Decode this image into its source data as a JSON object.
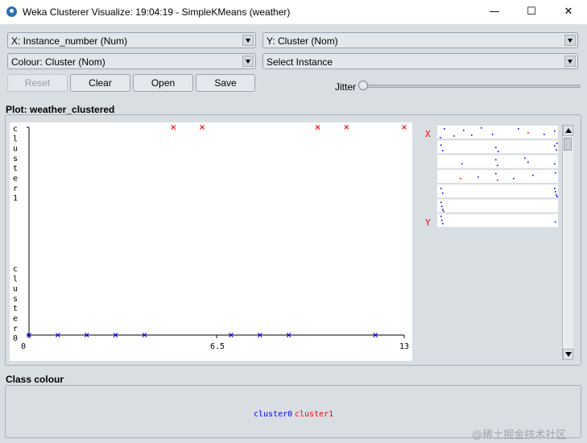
{
  "window": {
    "title": "Weka Clusterer Visualize: 19:04:19 - SimpleKMeans (weather)",
    "minimize_glyph": "—",
    "maximize_glyph": "☐",
    "close_glyph": "✕"
  },
  "controls": {
    "x_axis": "X: Instance_number (Num)",
    "y_axis": "Y: Cluster (Nom)",
    "colour": "Colour: Cluster (Nom)",
    "select_instance": "Select Instance",
    "buttons": {
      "reset": "Reset",
      "clear": "Clear",
      "open": "Open",
      "save": "Save"
    },
    "jitter_label": "Jitter",
    "jitter_value": 0
  },
  "plot": {
    "title": "Plot: weather_clustered",
    "y_top_label": "cluster1",
    "y_bottom_label": "cluster0",
    "x_ticks": [
      "0",
      "6.5",
      "13"
    ],
    "marker": "x"
  },
  "matrix": {
    "x_label": "X",
    "y_label": "Y"
  },
  "class_colour": {
    "title": "Class colour",
    "items": [
      {
        "name": "cluster0",
        "color": "#0000ff"
      },
      {
        "name": "cluster1",
        "color": "#ff0000"
      }
    ]
  },
  "watermark": "@稀土掘金技术社区",
  "chart_data": {
    "type": "scatter",
    "xlabel": "Instance_number",
    "ylabel": "Cluster",
    "xlim": [
      0,
      13
    ],
    "y_categories": [
      "cluster0",
      "cluster1"
    ],
    "series": [
      {
        "name": "cluster0",
        "color": "#0000ff",
        "x": [
          0,
          1,
          2,
          3,
          4,
          7,
          8,
          9,
          12
        ],
        "y": [
          "cluster0",
          "cluster0",
          "cluster0",
          "cluster0",
          "cluster0",
          "cluster0",
          "cluster0",
          "cluster0",
          "cluster0"
        ]
      },
      {
        "name": "cluster1",
        "color": "#ff0000",
        "x": [
          5,
          6,
          10,
          11,
          13
        ],
        "y": [
          "cluster1",
          "cluster1",
          "cluster1",
          "cluster1",
          "cluster1"
        ]
      }
    ]
  }
}
